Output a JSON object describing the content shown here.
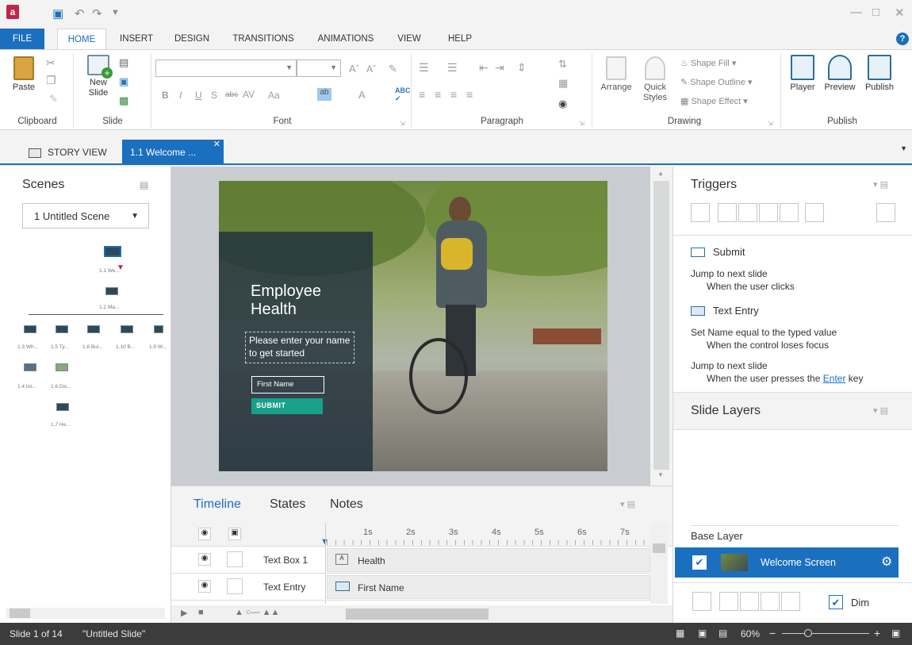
{
  "tabs": [
    "FILE",
    "HOME",
    "INSERT",
    "DESIGN",
    "TRANSITIONS",
    "ANIMATIONS",
    "VIEW",
    "HELP"
  ],
  "ribbon": {
    "clipboard": {
      "paste": "Paste",
      "label": "Clipboard"
    },
    "slide": {
      "new_slide": "New Slide",
      "label": "Slide"
    },
    "font": {
      "label": "Font"
    },
    "paragraph": {
      "label": "Paragraph"
    },
    "drawing": {
      "arrange": "Arrange",
      "quick_styles": "Quick Styles",
      "shape_fill": "Shape Fill",
      "shape_outline": "Shape Outline",
      "shape_effect": "Shape Effect",
      "label": "Drawing"
    },
    "publish": {
      "player": "Player",
      "preview": "Preview",
      "publish": "Publish",
      "label": "Publish"
    }
  },
  "doc_tabs": {
    "story_view": "STORY VIEW",
    "current": "1.1 Welcome ..."
  },
  "scenes": {
    "title": "Scenes",
    "dropdown": "1 Untitled Scene",
    "nodes": [
      "1.1 We...",
      "1.2 Ma...",
      "1.3 Wh...",
      "1.5 Ty...",
      "1.8 Bul...",
      "1.10 B...",
      "1.9 W...",
      "1.4 Int...",
      "1.6 Dis...",
      "1.7 He..."
    ]
  },
  "slide": {
    "title": "Employee Health",
    "prompt": "Please enter your name to get started",
    "input_placeholder": "First Name",
    "submit": "SUBMIT"
  },
  "timeline": {
    "tabs": [
      "Timeline",
      "States",
      "Notes"
    ],
    "ticks": [
      "1s",
      "2s",
      "3s",
      "4s",
      "5s",
      "6s",
      "7s"
    ],
    "rows": [
      {
        "name": "Text Box 1",
        "content": "Health"
      },
      {
        "name": "Text Entry",
        "content": "First Name"
      }
    ]
  },
  "triggers": {
    "title": "Triggers",
    "items": [
      {
        "object": "Submit",
        "action": "Jump to next slide",
        "condition": "When the user clicks"
      },
      {
        "object": "Text Entry",
        "action": "Set Name equal to the typed value",
        "condition": "When the control loses focus"
      },
      {
        "object": "",
        "action": "Jump to next slide",
        "condition_prefix": "When the user presses the",
        "condition_link": "Enter",
        "condition_suffix": "key"
      }
    ]
  },
  "layers": {
    "title": "Slide Layers",
    "base": "Base Layer",
    "selected": "Welcome Screen",
    "dim": "Dim"
  },
  "status": {
    "slide": "Slide 1 of 14",
    "name": "\"Untitled Slide\"",
    "zoom": "60%"
  },
  "colors": {
    "accent": "#1b6fbf",
    "submit": "#18a08a",
    "status_bg": "#3c3c3c"
  }
}
